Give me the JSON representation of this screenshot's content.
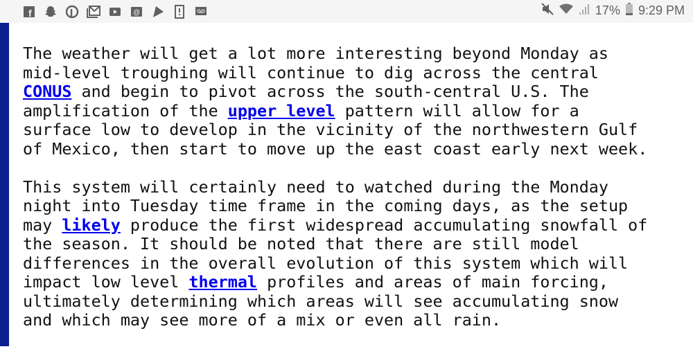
{
  "status_bar": {
    "notification_icons": [
      "facebook-icon",
      "snapchat-icon",
      "pinterest-icon",
      "gmail-icon",
      "youtube-icon",
      "email-icon",
      "play-store-icon",
      "alert-icon",
      "voicemail-icon"
    ],
    "battery": "17%",
    "time": "9:29 PM",
    "color": "#606060"
  },
  "accent_bar_color": "#0c1f8e",
  "article": {
    "paragraphs": [
      {
        "lines": [
          [
            "The weather will get a lot more interesting beyond Monday as"
          ],
          [
            "mid-level troughing will continue to dig across the central"
          ],
          [
            {
              "link": "CONUS"
            },
            " and begin to pivot across the south-central U.S. The"
          ],
          [
            "amplification of the ",
            {
              "link": "upper level"
            },
            " pattern will allow for a"
          ],
          [
            "surface low to develop in the vicinity of the northwestern Gulf"
          ],
          [
            "of Mexico, then start to move up the east coast early next week."
          ]
        ]
      },
      {
        "lines": [
          [
            "This system will certainly need to watched during the Monday"
          ],
          [
            "night into Tuesday time frame in the coming days, as the setup"
          ],
          [
            "may ",
            {
              "link": "likely"
            },
            " produce the first widespread accumulating snowfall of"
          ],
          [
            "the season. It should be noted that there are still model"
          ],
          [
            "differences in the overall evolution of this system which will"
          ],
          [
            "impact low level ",
            {
              "link": "thermal"
            },
            " profiles and areas of main forcing,"
          ],
          [
            "ultimately determining which areas will see accumulating snow"
          ],
          [
            "and which may see more of a mix or even all rain."
          ]
        ]
      }
    ]
  }
}
